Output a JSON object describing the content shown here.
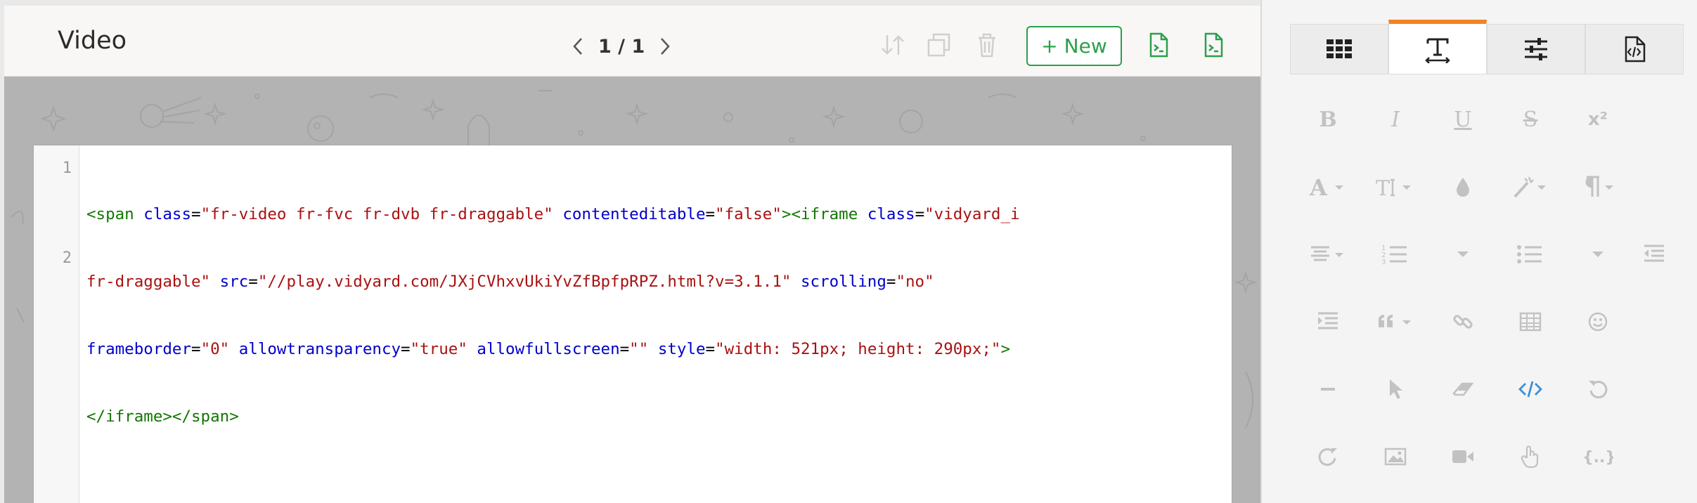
{
  "header": {
    "title": "Video",
    "pager": "1 / 1",
    "new_button": "+ New"
  },
  "editor": {
    "line_numbers": [
      "1",
      "2"
    ],
    "code_line_1": [
      {
        "c": "tg",
        "t": "<span "
      },
      {
        "c": "at",
        "t": "class"
      },
      {
        "c": "pl",
        "t": "="
      },
      {
        "c": "st",
        "t": "\"fr-video fr-fvc fr-dvb fr-draggable\""
      },
      {
        "c": "pl",
        "t": " "
      },
      {
        "c": "at",
        "t": "contenteditable"
      },
      {
        "c": "pl",
        "t": "="
      },
      {
        "c": "st",
        "t": "\"false\""
      },
      {
        "c": "tg",
        "t": "><iframe "
      },
      {
        "c": "at",
        "t": "class"
      },
      {
        "c": "pl",
        "t": "="
      },
      {
        "c": "st",
        "t": "\"vidyard_i"
      }
    ],
    "code_line_1b": [
      {
        "c": "st",
        "t": "fr-draggable\""
      },
      {
        "c": "pl",
        "t": " "
      },
      {
        "c": "at",
        "t": "src"
      },
      {
        "c": "pl",
        "t": "="
      },
      {
        "c": "st",
        "t": "\"//play.vidyard.com/JXjCVhxvUkiYvZfBpfpRPZ.html?v=3.1.1\""
      },
      {
        "c": "pl",
        "t": " "
      },
      {
        "c": "at",
        "t": "scrolling"
      },
      {
        "c": "pl",
        "t": "="
      },
      {
        "c": "st",
        "t": "\"no\""
      }
    ],
    "code_line_1c": [
      {
        "c": "at",
        "t": "frameborder"
      },
      {
        "c": "pl",
        "t": "="
      },
      {
        "c": "st",
        "t": "\"0\""
      },
      {
        "c": "pl",
        "t": " "
      },
      {
        "c": "at",
        "t": "allowtransparency"
      },
      {
        "c": "pl",
        "t": "="
      },
      {
        "c": "st",
        "t": "\"true\""
      },
      {
        "c": "pl",
        "t": " "
      },
      {
        "c": "at",
        "t": "allowfullscreen"
      },
      {
        "c": "pl",
        "t": "="
      },
      {
        "c": "st",
        "t": "\"\""
      },
      {
        "c": "pl",
        "t": " "
      },
      {
        "c": "at",
        "t": "style"
      },
      {
        "c": "pl",
        "t": "="
      },
      {
        "c": "st",
        "t": "\"width: 521px; height: 290px;\""
      },
      {
        "c": "tg",
        "t": ">"
      }
    ],
    "code_line_1d": [
      {
        "c": "tg",
        "t": "</iframe></span>"
      }
    ]
  },
  "toolbar_tabs": [
    {
      "name": "tab-widgets",
      "icon": "grid-icon",
      "active": false
    },
    {
      "name": "tab-text",
      "icon": "text-format-icon",
      "active": true
    },
    {
      "name": "tab-settings",
      "icon": "sliders-icon",
      "active": false
    },
    {
      "name": "tab-code",
      "icon": "code-file-icon",
      "active": false
    }
  ],
  "tools": [
    {
      "label": "B",
      "icon": "bold-icon"
    },
    {
      "label": "I",
      "icon": "italic-icon"
    },
    {
      "label": "U",
      "icon": "underline-icon"
    },
    {
      "label": "S",
      "icon": "strikethrough-icon"
    },
    {
      "label": "x²",
      "icon": "superscript-icon"
    }
  ],
  "colors": {
    "accent_orange": "#f58220",
    "green": "#2aa04a",
    "code_blue_active": "#3d8fd6"
  }
}
